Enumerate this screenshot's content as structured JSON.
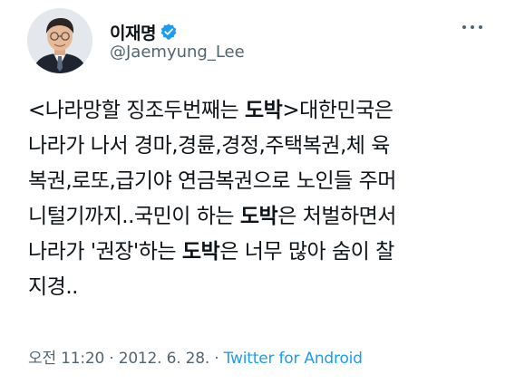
{
  "author": {
    "display_name": "이재명",
    "handle": "@Jaemyung_Lee",
    "verified": true,
    "verified_color": "#1d9bf0"
  },
  "more_menu": {
    "icon": "more-horizontal-icon"
  },
  "tweet": {
    "lines": [
      [
        {
          "text": "<나라망할 징조두번째는 "
        },
        {
          "text": "도박",
          "bold": true
        },
        {
          "text": ">대한민국은"
        }
      ],
      [
        {
          "text": "나라가 나서 경마,경륜,경정,주택복권,체 육"
        }
      ],
      [
        {
          "text": "복권,로또,급기야 연금복권으로 노인들 주머"
        }
      ],
      [
        {
          "text": "니털기까지..국민이 하는 "
        },
        {
          "text": "도박",
          "bold": true
        },
        {
          "text": "은 처벌하면서"
        }
      ],
      [
        {
          "text": "나라가 '권장'하는 "
        },
        {
          "text": "도박",
          "bold": true
        },
        {
          "text": "은 너무 많아 숨이 찰"
        }
      ],
      [
        {
          "text": "지경.."
        }
      ]
    ]
  },
  "meta": {
    "time": "오전 11:20",
    "separator1": " · ",
    "date": "2012. 6. 28.",
    "separator2": " · ",
    "source": "Twitter for Android",
    "source_color": "#1d9bf0"
  }
}
